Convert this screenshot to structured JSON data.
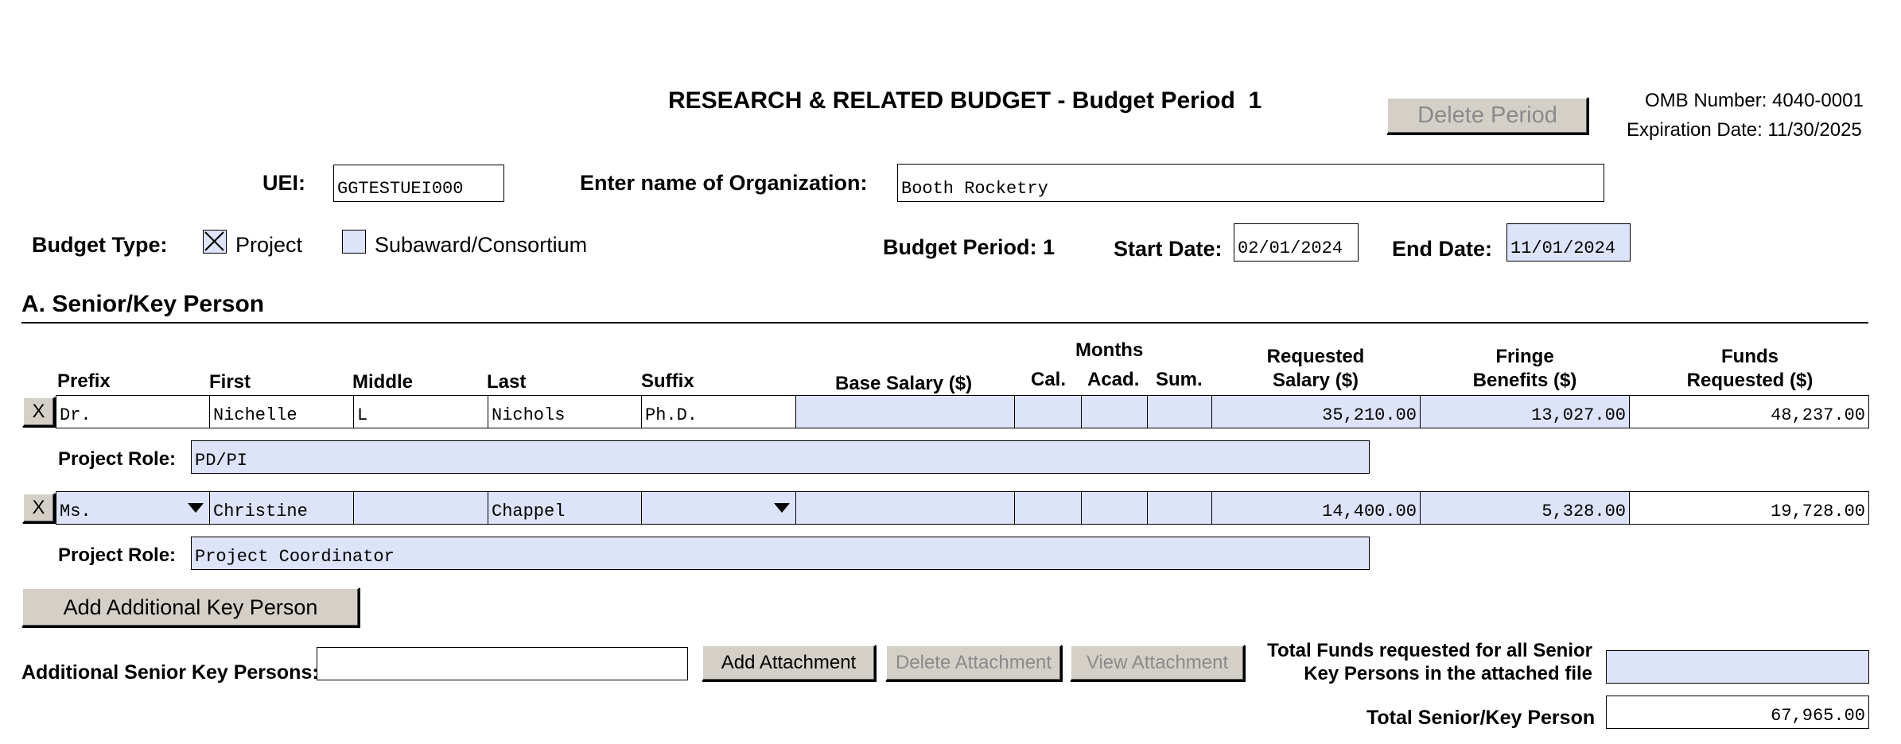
{
  "title": "RESEARCH & RELATED BUDGET - Budget Period  1",
  "omb": {
    "number": "OMB Number: 4040-0001",
    "expiration": "Expiration Date: 11/30/2025"
  },
  "buttons": {
    "delete_period": "Delete Period",
    "add_key_person": "Add Additional Key Person",
    "add_attachment": "Add Attachment",
    "delete_attachment": "Delete Attachment",
    "view_attachment": "View Attachment",
    "remove": "X"
  },
  "org": {
    "uei_label": "UEI:",
    "uei_value": "GGTESTUEI000",
    "name_label": "Enter name of Organization:",
    "name_value": "Booth Rocketry"
  },
  "budget": {
    "type_label": "Budget Type:",
    "project_label": "Project",
    "subaward_label": "Subaward/Consortium",
    "period_label": "Budget Period: 1",
    "start_label": "Start Date:",
    "start_value": "02/01/2024",
    "end_label": "End Date:",
    "end_value": "11/01/2024"
  },
  "section_a": {
    "title": "A. Senior/Key Person",
    "headers": {
      "prefix": "Prefix",
      "first": "First",
      "middle": "Middle",
      "last": "Last",
      "suffix": "Suffix",
      "base_salary": "Base Salary ($)",
      "months": "Months",
      "cal": "Cal.",
      "acad": "Acad.",
      "sum": "Sum.",
      "requested_1": "Requested",
      "requested_2": "Salary ($)",
      "fringe_1": "Fringe",
      "fringe_2": "Benefits ($)",
      "funds_1": "Funds",
      "funds_2": "Requested ($)"
    },
    "role_label": "Project Role:",
    "persons": [
      {
        "prefix": "Dr.",
        "first": "Nichelle",
        "middle": "L",
        "last": "Nichols",
        "suffix": "Ph.D.",
        "base_salary": "",
        "cal": "",
        "acad": "",
        "sum": "",
        "requested_salary": "35,210.00",
        "fringe": "13,027.00",
        "funds": "48,237.00",
        "role": "PD/PI"
      },
      {
        "prefix": "Ms.",
        "first": "Christine",
        "middle": "",
        "last": "Chappel",
        "suffix": "",
        "base_salary": "",
        "cal": "",
        "acad": "",
        "sum": "",
        "requested_salary": "14,400.00",
        "fringe": "5,328.00",
        "funds": "19,728.00",
        "role": "Project Coordinator"
      }
    ]
  },
  "attachments": {
    "label": "Additional Senior Key Persons:",
    "file_value": "",
    "total_attached_label_1": "Total Funds requested for all Senior",
    "total_attached_label_2": "Key Persons in the attached file",
    "total_attached_value": "",
    "total_label": "Total Senior/Key Person",
    "total_value": "67,965.00"
  }
}
